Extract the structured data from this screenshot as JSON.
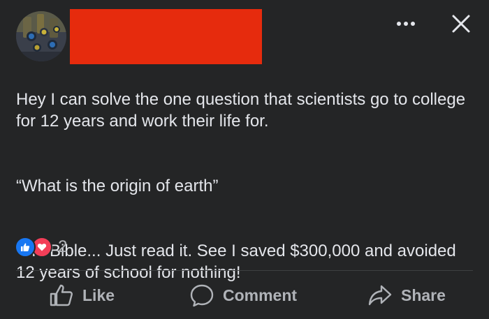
{
  "post": {
    "author_redacted": true,
    "body": {
      "paragraph1": "Hey I can solve the one question that scientists go to college for 12 years and work their life for.",
      "paragraph2": "“What is the origin of earth”",
      "paragraph3": "The Bible... Just read it. See I saved $300,000 and avoided 12 years of school for nothing!"
    },
    "reactions": {
      "types": [
        "like-icon",
        "love-icon"
      ],
      "count": "2",
      "colors": {
        "like": "#1877f2",
        "love": "#f33e58"
      }
    }
  },
  "header": {
    "menu_icon": "more-horizontal-icon",
    "close_icon": "close-icon",
    "redaction_color": "#e62b0d"
  },
  "actions": {
    "like_label": "Like",
    "comment_label": "Comment",
    "share_label": "Share"
  },
  "theme": {
    "background": "#242526",
    "text": "#e4e6eb",
    "secondary_text": "#b0b3b8"
  }
}
